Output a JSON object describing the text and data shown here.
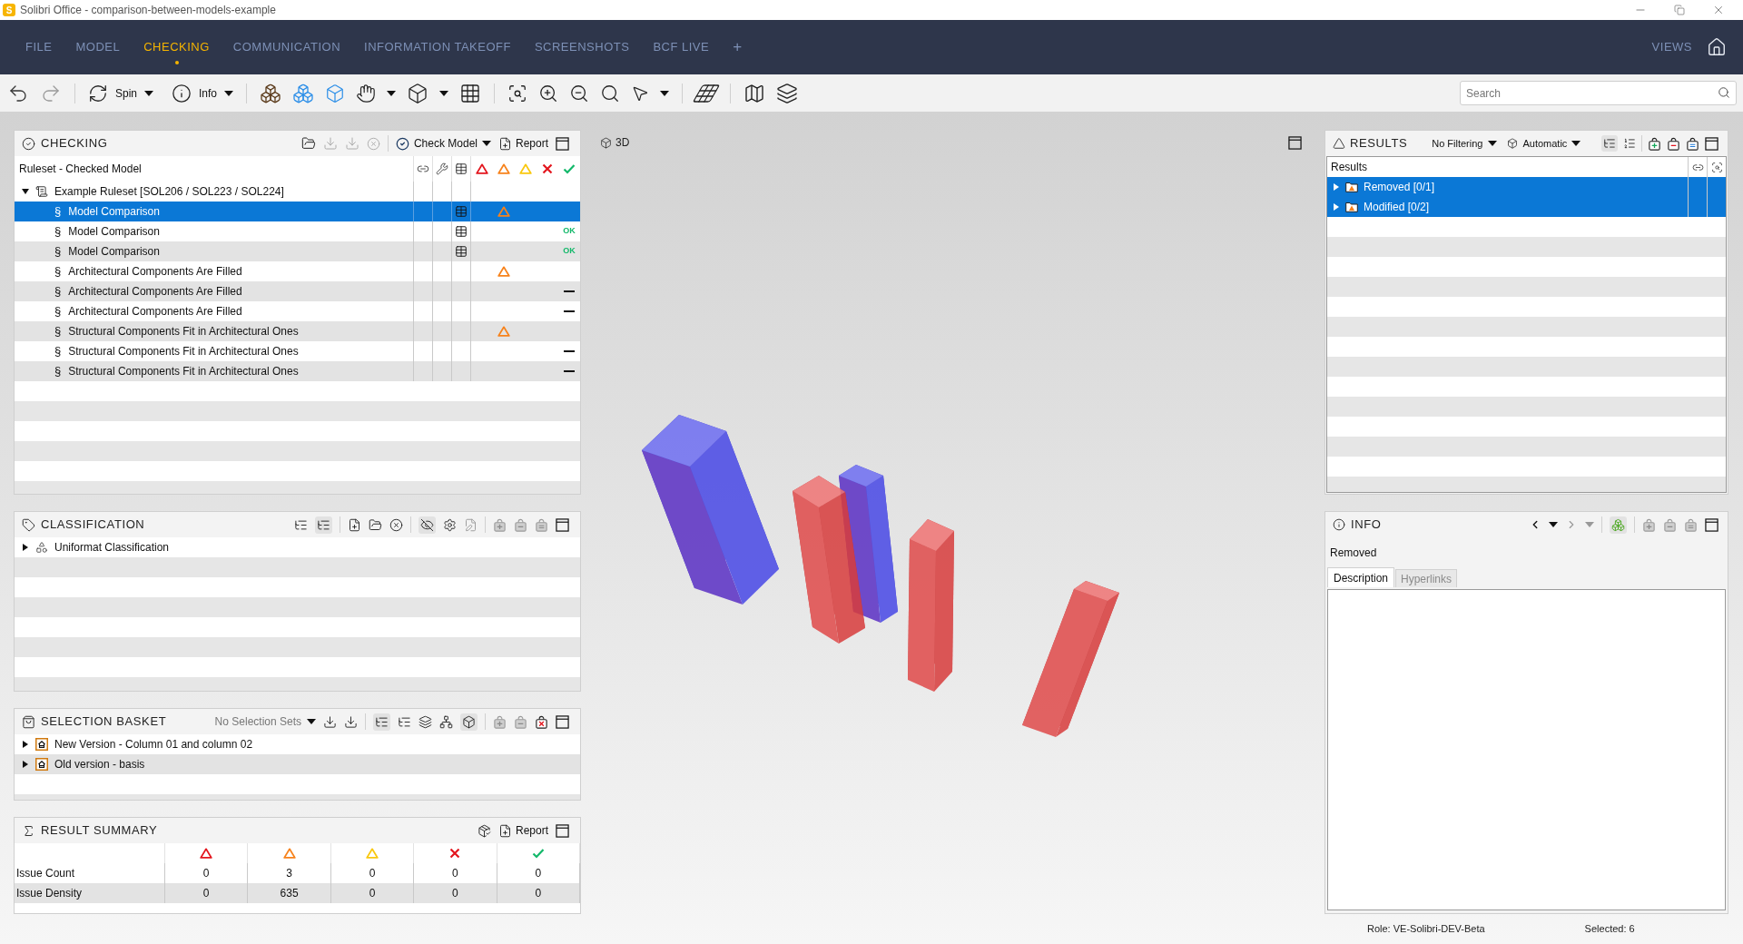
{
  "window": {
    "logo": "S",
    "title": "Solibri Office - comparison-between-models-example"
  },
  "menu": {
    "tabs": [
      {
        "label": "FILE",
        "selected": false
      },
      {
        "label": "MODEL",
        "selected": false
      },
      {
        "label": "CHECKING",
        "selected": true
      },
      {
        "label": "COMMUNICATION",
        "selected": false
      },
      {
        "label": "INFORMATION TAKEOFF",
        "selected": false
      },
      {
        "label": "SCREENSHOTS",
        "selected": false
      },
      {
        "label": "BCF LIVE",
        "selected": false
      }
    ],
    "add_tab": "+",
    "views": "VIEWS"
  },
  "toolbar": {
    "spin": "Spin",
    "info": "Info",
    "search": {
      "placeholder": "Search"
    }
  },
  "checking": {
    "title": "CHECKING",
    "check_model": "Check Model",
    "report": "Report",
    "column_header": "Ruleset - Checked Model",
    "ruleset": {
      "label": "Example Ruleset [SOL206 / SOL223 / SOL224]",
      "expanded": true,
      "selected": false,
      "children": [
        {
          "symbol": "§",
          "label": "Model Comparison",
          "selected": true,
          "has_table": true,
          "kind": "moderate"
        },
        {
          "symbol": "§",
          "label": "Model Comparison",
          "selected": false,
          "has_table": true,
          "kind": "ok",
          "status_text": "OK"
        },
        {
          "symbol": "§",
          "label": "Model Comparison",
          "selected": false,
          "has_table": true,
          "kind": "ok",
          "status_text": "OK"
        },
        {
          "symbol": "§",
          "label": "Architectural Components Are Filled",
          "selected": false,
          "has_table": false,
          "kind": "moderate"
        },
        {
          "symbol": "§",
          "label": "Architectural Components Are Filled",
          "selected": false,
          "has_table": false,
          "kind": "not_checked"
        },
        {
          "symbol": "§",
          "label": "Architectural Components Are Filled",
          "selected": false,
          "has_table": false,
          "kind": "not_checked"
        },
        {
          "symbol": "§",
          "label": "Structural Components Fit in Architectural Ones",
          "selected": false,
          "has_table": false,
          "kind": "moderate"
        },
        {
          "symbol": "§",
          "label": "Structural Components Fit in Architectural Ones",
          "selected": false,
          "has_table": false,
          "kind": "not_checked"
        },
        {
          "symbol": "§",
          "label": "Structural Components Fit in Architectural Ones",
          "selected": false,
          "has_table": false,
          "kind": "not_checked"
        }
      ]
    }
  },
  "classification": {
    "title": "CLASSIFICATION",
    "items": [
      {
        "label": "Uniformat Classification",
        "expanded": false,
        "selected": false
      }
    ]
  },
  "selection_basket": {
    "title": "SELECTION BASKET",
    "selection_sets": "No Selection Sets",
    "items": [
      {
        "label": "New Version - Column 01 and column 02",
        "expanded": false,
        "selected": false
      },
      {
        "label": "Old version - basis",
        "expanded": false,
        "selected": false
      }
    ]
  },
  "result_summary": {
    "title": "RESULT SUMMARY",
    "report": "Report",
    "columns": [
      {
        "kind": "critical"
      },
      {
        "kind": "moderate"
      },
      {
        "kind": "low"
      },
      {
        "kind": "rejected"
      },
      {
        "kind": "accepted"
      }
    ],
    "rows": [
      {
        "label": "Issue Count",
        "values": [
          "0",
          "3",
          "0",
          "0",
          "0"
        ]
      },
      {
        "label": "Issue Density",
        "values": [
          "0",
          "635",
          "0",
          "0",
          "0"
        ]
      }
    ]
  },
  "view_3d": {
    "title": "3D"
  },
  "results": {
    "title": "RESULTS",
    "filter": "No Filtering",
    "mode": "Automatic",
    "column_header": "Results",
    "items": [
      {
        "label": "Removed [0/1]",
        "expanded": false,
        "selected": true
      },
      {
        "label": "Modified [0/2]",
        "expanded": false,
        "selected": true
      }
    ]
  },
  "info": {
    "title": "INFO",
    "subject": "Removed",
    "tabs": [
      {
        "label": "Description",
        "selected": true
      },
      {
        "label": "Hyperlinks",
        "selected": false
      }
    ]
  },
  "status_bar": {
    "role": "Role: VE-Solibri-DEV-Beta",
    "selected": "Selected: 6"
  }
}
